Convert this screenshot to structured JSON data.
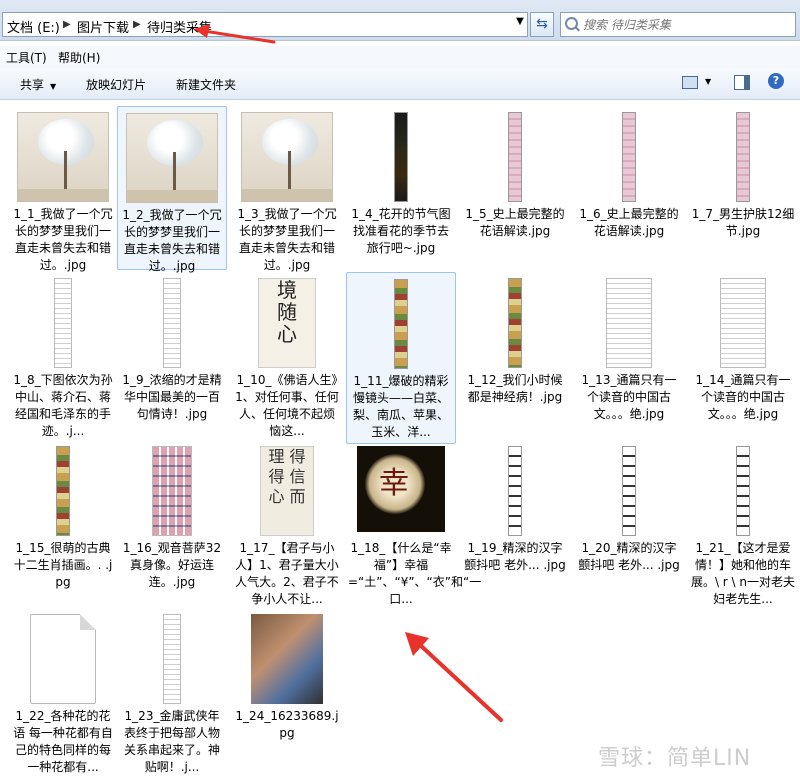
{
  "address": {
    "crumbs": [
      "文档 (E:)",
      "图片下载",
      "待归类采集"
    ]
  },
  "search": {
    "placeholder": "搜索 待归类采集"
  },
  "menu": {
    "items": [
      "工具(T)",
      "帮助(H)"
    ]
  },
  "toolbar": {
    "share": "共享",
    "slideshow": "放映幻灯片",
    "new_folder": "新建文件夹"
  },
  "files": [
    {
      "name": "1_1_我做了一个冗长的梦梦里我们一直走未曾失去和错过。.jpg",
      "thumb": "tree"
    },
    {
      "name": "1_2_我做了一个冗长的梦梦里我们一直走未曾失去和错过。.jpg",
      "thumb": "tree",
      "selected": true
    },
    {
      "name": "1_3_我做了一个冗长的梦梦里我们一直走未曾失去和错过。.jpg",
      "thumb": "tree"
    },
    {
      "name": "1_4_花开的节气图找准看花的季节去旅行吧~.jpg",
      "thumb": "dark-strip"
    },
    {
      "name": "1_5_史上最完整的花语解读.jpg",
      "thumb": "pink-strip"
    },
    {
      "name": "1_6_史上最完整的花语解读.jpg",
      "thumb": "pink-strip"
    },
    {
      "name": "1_7_男生护肤12细节.jpg",
      "thumb": "pink-strip"
    },
    {
      "name": "1_8_下图依次为孙中山、蒋介石、蒋经国和毛泽东的手迹。.j...",
      "thumb": "doc-narrow"
    },
    {
      "name": "1_9_浓缩的才是精华中国最美的一百句情诗！.jpg",
      "thumb": "doc-narrow"
    },
    {
      "name": "1_10_《佛语人生》1、对任何事、任何人、任何境不起烦恼这...",
      "thumb": "callig"
    },
    {
      "name": "1_11_爆破的精彩慢镜头——白菜、梨、南瓜、苹果、玉米、洋...",
      "thumb": "multi-strip",
      "selected": true
    },
    {
      "name": "1_12_我们小时候都是神经病！.jpg",
      "thumb": "multi-strip"
    },
    {
      "name": "1_13_通篇只有一个读音的中国古文。。。绝.jpg",
      "thumb": "doc"
    },
    {
      "name": "1_14_通篇只有一个读音的中国古文。。。绝.jpg",
      "thumb": "doc"
    },
    {
      "name": "1_15_很萌的古典十二生肖插画。. .jpg",
      "thumb": "multi-strip"
    },
    {
      "name": "1_16_观音菩萨32真身像。好运连连。.jpg",
      "thumb": "grid"
    },
    {
      "name": "1_17_【君子与小人】1、君子量大小人气大。2、君子不争小人不让...",
      "thumb": "callig2"
    },
    {
      "name": "1_18_【什么是“幸福”】幸福=“土”、“¥”、“衣”和“一口...",
      "thumb": "photo-dark"
    },
    {
      "name": "1_19_精深的汉字颤抖吧 老外... .jpg",
      "thumb": "icons"
    },
    {
      "name": "1_20_精深的汉字颤抖吧 老外... .jpg",
      "thumb": "icons"
    },
    {
      "name": "1_21_【这才是爱情！】她和他的车展。\\ r \\ n一对老夫妇老先生...",
      "thumb": "icons"
    },
    {
      "name": "1_22_各种花的花语 每一种花都有自己的特色同样的每一种花都有...",
      "thumb": "blank"
    },
    {
      "name": "1_23_金庸武侠年表终于把每部人物关系串起来了。神贴啊！.j...",
      "thumb": "doc-narrow"
    },
    {
      "name": "1_24_16233689.jpg",
      "thumb": "photo-kids"
    }
  ],
  "watermark": "雪球：简单LIN",
  "colors": {
    "annotation_arrow": "#e8322a",
    "selection": "#9cc6ec"
  }
}
